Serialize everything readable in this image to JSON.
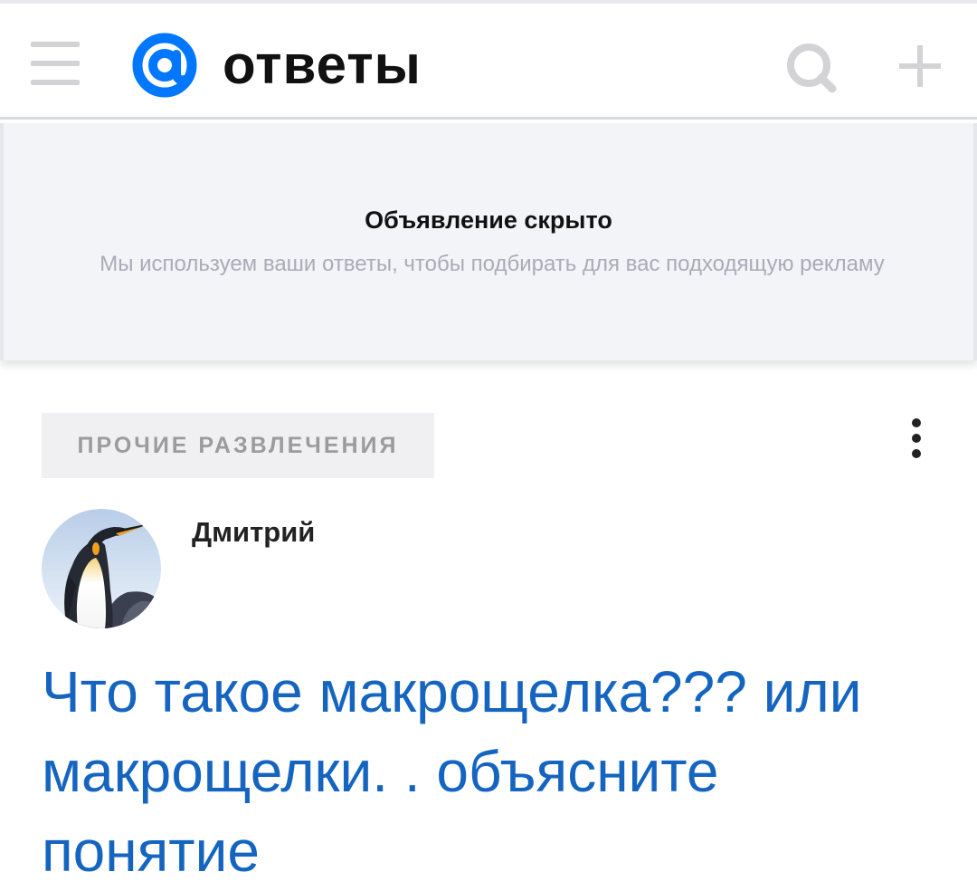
{
  "header": {
    "logo_text": "ответы",
    "icons": {
      "menu": "menu-icon",
      "logo": "at-sign-logo-icon",
      "search": "search-icon",
      "add": "plus-icon"
    },
    "colors": {
      "logo_blue": "#0077ff",
      "icon_gray": "#d3d3d6"
    }
  },
  "ad": {
    "title": "Объявление скрыто",
    "subtitle": "Мы используем ваши ответы, чтобы подбирать для вас подходящую рекламу"
  },
  "question": {
    "category": "ПРОЧИЕ РАЗВЛЕЧЕНИЯ",
    "author": "Дмитрий",
    "title": "Что такое макрощелка??? или макрощелки. . объясните понятие",
    "title_color": "#1565c0"
  }
}
